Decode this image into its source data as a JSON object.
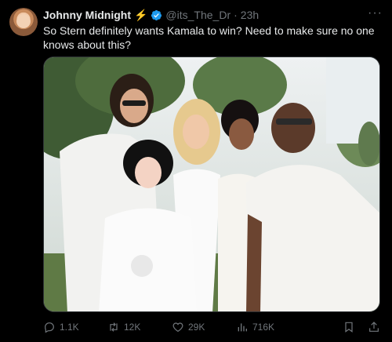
{
  "tweet": {
    "author_name": "Johnny Midnight",
    "name_emoji": "⚡",
    "handle": "@its_The_Dr",
    "separator": "·",
    "time": "23h",
    "more_label": "···",
    "text": "So Stern definitely wants Kamala to win? Need to make sure no one knows about this?"
  },
  "actions": {
    "replies": "1.1K",
    "reposts": "12K",
    "likes": "29K",
    "views": "716K"
  },
  "icons": {
    "verified": "verified-badge-icon",
    "reply": "reply-icon",
    "repost": "repost-icon",
    "like": "heart-icon",
    "views": "views-icon",
    "bookmark": "bookmark-icon",
    "share": "share-icon"
  },
  "colors": {
    "background": "#000000",
    "text": "#e7e9ea",
    "muted": "#71767b",
    "verified": "#1d9bf0",
    "bolt": "#f4c430"
  }
}
